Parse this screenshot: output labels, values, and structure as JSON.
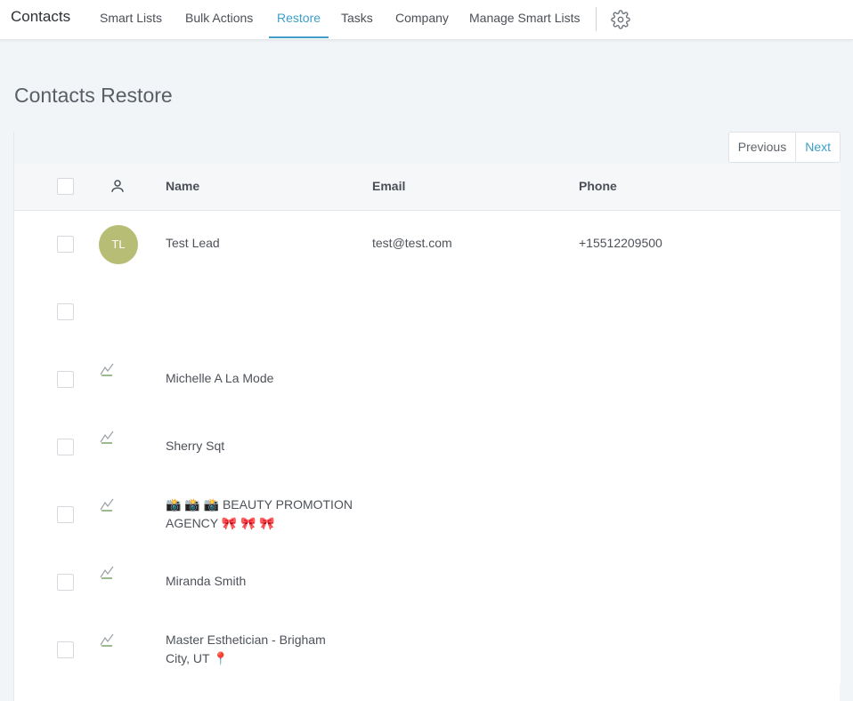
{
  "app_title": "Contacts",
  "nav": {
    "tabs": [
      {
        "label": "Smart Lists"
      },
      {
        "label": "Bulk Actions"
      },
      {
        "label": "Restore"
      },
      {
        "label": "Tasks"
      },
      {
        "label": "Company"
      },
      {
        "label": "Manage Smart Lists"
      }
    ],
    "active_tab": "Restore",
    "settings_icon": "gear-icon"
  },
  "page_title": "Contacts Restore",
  "pagination": {
    "previous_label": "Previous",
    "next_label": "Next"
  },
  "table": {
    "columns": {
      "avatar_icon": "user-icon",
      "name": "Name",
      "email": "Email",
      "phone": "Phone"
    },
    "rows": [
      {
        "avatar_initials": "TL",
        "avatar_color": "#b8bd76",
        "name_line1": "Test Lead",
        "name_line2": "",
        "email": "test@test.com",
        "phone": "+15512209500"
      },
      {
        "avatar_initials": "",
        "name_line1": "",
        "name_line2": "",
        "email": "",
        "phone": ""
      },
      {
        "avatar_initials": "",
        "name_line1": "Michelle A La Mode",
        "name_line2": "",
        "email": "",
        "phone": ""
      },
      {
        "avatar_initials": "",
        "name_line1": "Sherry Sqt",
        "name_line2": "",
        "email": "",
        "phone": ""
      },
      {
        "avatar_initials": "",
        "name_line1": "📸 📸 📸 BEAUTY PROMOTION",
        "name_line2": "AGENCY 🎀 🎀 🎀",
        "email": "",
        "phone": ""
      },
      {
        "avatar_initials": "",
        "name_line1": "Miranda Smith",
        "name_line2": "",
        "email": "",
        "phone": ""
      },
      {
        "avatar_initials": "",
        "name_line1": "Master Esthetician - Brigham",
        "name_line2": "City, UT 📍",
        "email": "",
        "phone": ""
      }
    ]
  },
  "colors": {
    "accent": "#3c9ec9",
    "background": "#f1f5f8"
  }
}
